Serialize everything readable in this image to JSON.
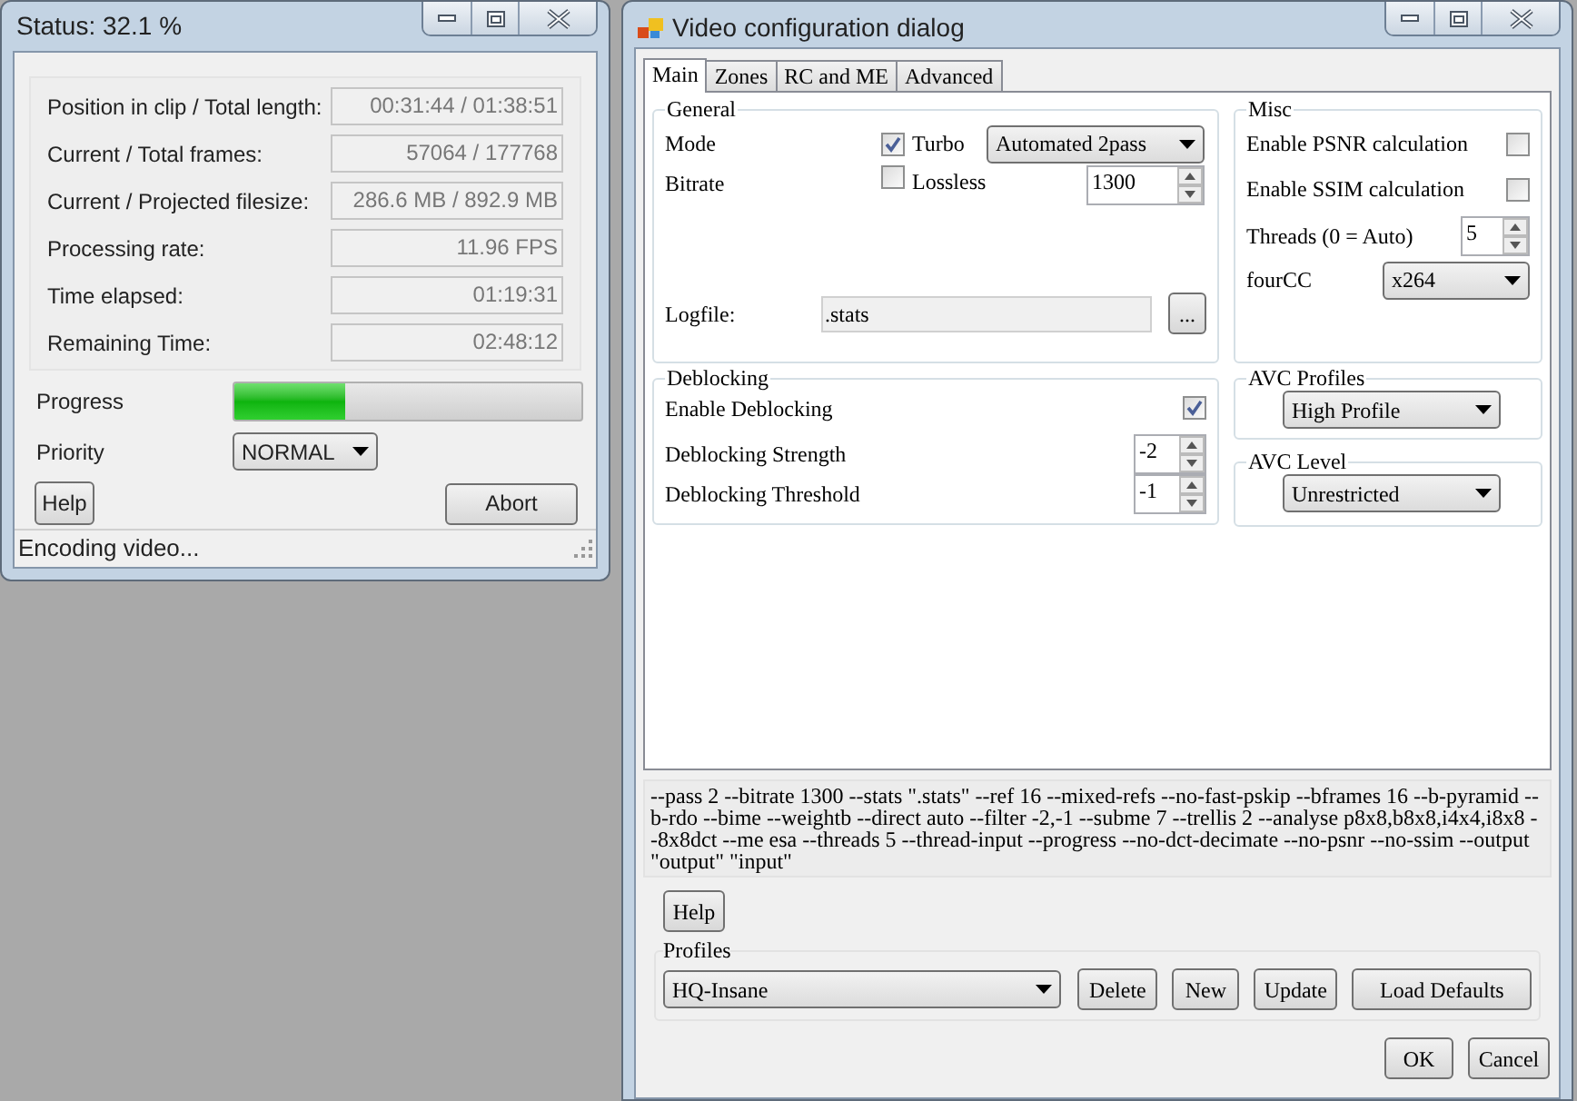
{
  "status_window": {
    "title": "Status: 32.1 %",
    "fields": [
      {
        "label": "Position in clip / Total length:",
        "value": "00:31:44 / 01:38:51"
      },
      {
        "label": "Current / Total frames:",
        "value": "57064 / 177768"
      },
      {
        "label": "Current / Projected filesize:",
        "value": "286.6 MB / 892.9 MB"
      },
      {
        "label": "Processing rate:",
        "value": "11.96 FPS"
      },
      {
        "label": "Time elapsed:",
        "value": "01:19:31"
      },
      {
        "label": "Remaining Time:",
        "value": "02:48:12"
      }
    ],
    "progress": {
      "label": "Progress",
      "level": 0.32
    },
    "priority": {
      "label": "Priority",
      "value": "NORMAL"
    },
    "buttons": [
      "Help",
      "Abort"
    ],
    "status_bar": "Encoding video..."
  },
  "config_dialog": {
    "title": "Video configuration dialog",
    "tabs": [
      {
        "label": "Main",
        "selected": true
      },
      {
        "label": "Zones",
        "selected": false
      },
      {
        "label": "RC and ME",
        "selected": false
      },
      {
        "label": "Advanced",
        "selected": false
      }
    ],
    "general": {
      "title": "General",
      "mode_label": "Mode",
      "turbo": {
        "label": "Turbo",
        "checked": true
      },
      "mode_value": "Automated 2pass",
      "bitrate_label": "Bitrate",
      "lossless": {
        "label": "Lossless",
        "checked": false
      },
      "bitrate_value": "1300",
      "logfile_label": "Logfile:",
      "logfile_value": ".stats",
      "browse_button": "..."
    },
    "deblocking": {
      "title": "Deblocking",
      "enable": {
        "label": "Enable Deblocking",
        "checked": true
      },
      "strength_label": "Deblocking Strength",
      "strength_value": "-2",
      "threshold_label": "Deblocking Threshold",
      "threshold_value": "-1"
    },
    "misc": {
      "title": "Misc",
      "psnr": {
        "label": "Enable PSNR calculation",
        "checked": false
      },
      "ssim": {
        "label": "Enable SSIM calculation",
        "checked": false
      },
      "threads_label": "Threads (0 = Auto)",
      "threads_value": "5",
      "fourcc_label": "fourCC",
      "fourcc_value": "x264"
    },
    "avc_profiles": {
      "title": "AVC Profiles",
      "value": "High Profile"
    },
    "avc_level": {
      "title": "AVC Level",
      "value": "Unrestricted"
    },
    "command_line": "--pass 2 --bitrate 1300 --stats \".stats\" --ref 16 --mixed-refs --no-fast-pskip --bframes 16 --b-pyramid --b-rdo --bime --weightb --direct auto --filter -2,-1 --subme 7 --trellis 2 --analyse p8x8,b8x8,i4x4,i8x8 --8x8dct --me esa --threads 5 --thread-input --progress --no-dct-decimate --no-psnr --no-ssim --output \"output\" \"input\"",
    "help_button": "Help",
    "profiles": {
      "title": "Profiles",
      "value": "HQ-Insane",
      "buttons": [
        "Delete",
        "New",
        "Update",
        "Load Defaults"
      ]
    },
    "dialog_buttons": [
      "OK",
      "Cancel"
    ]
  }
}
